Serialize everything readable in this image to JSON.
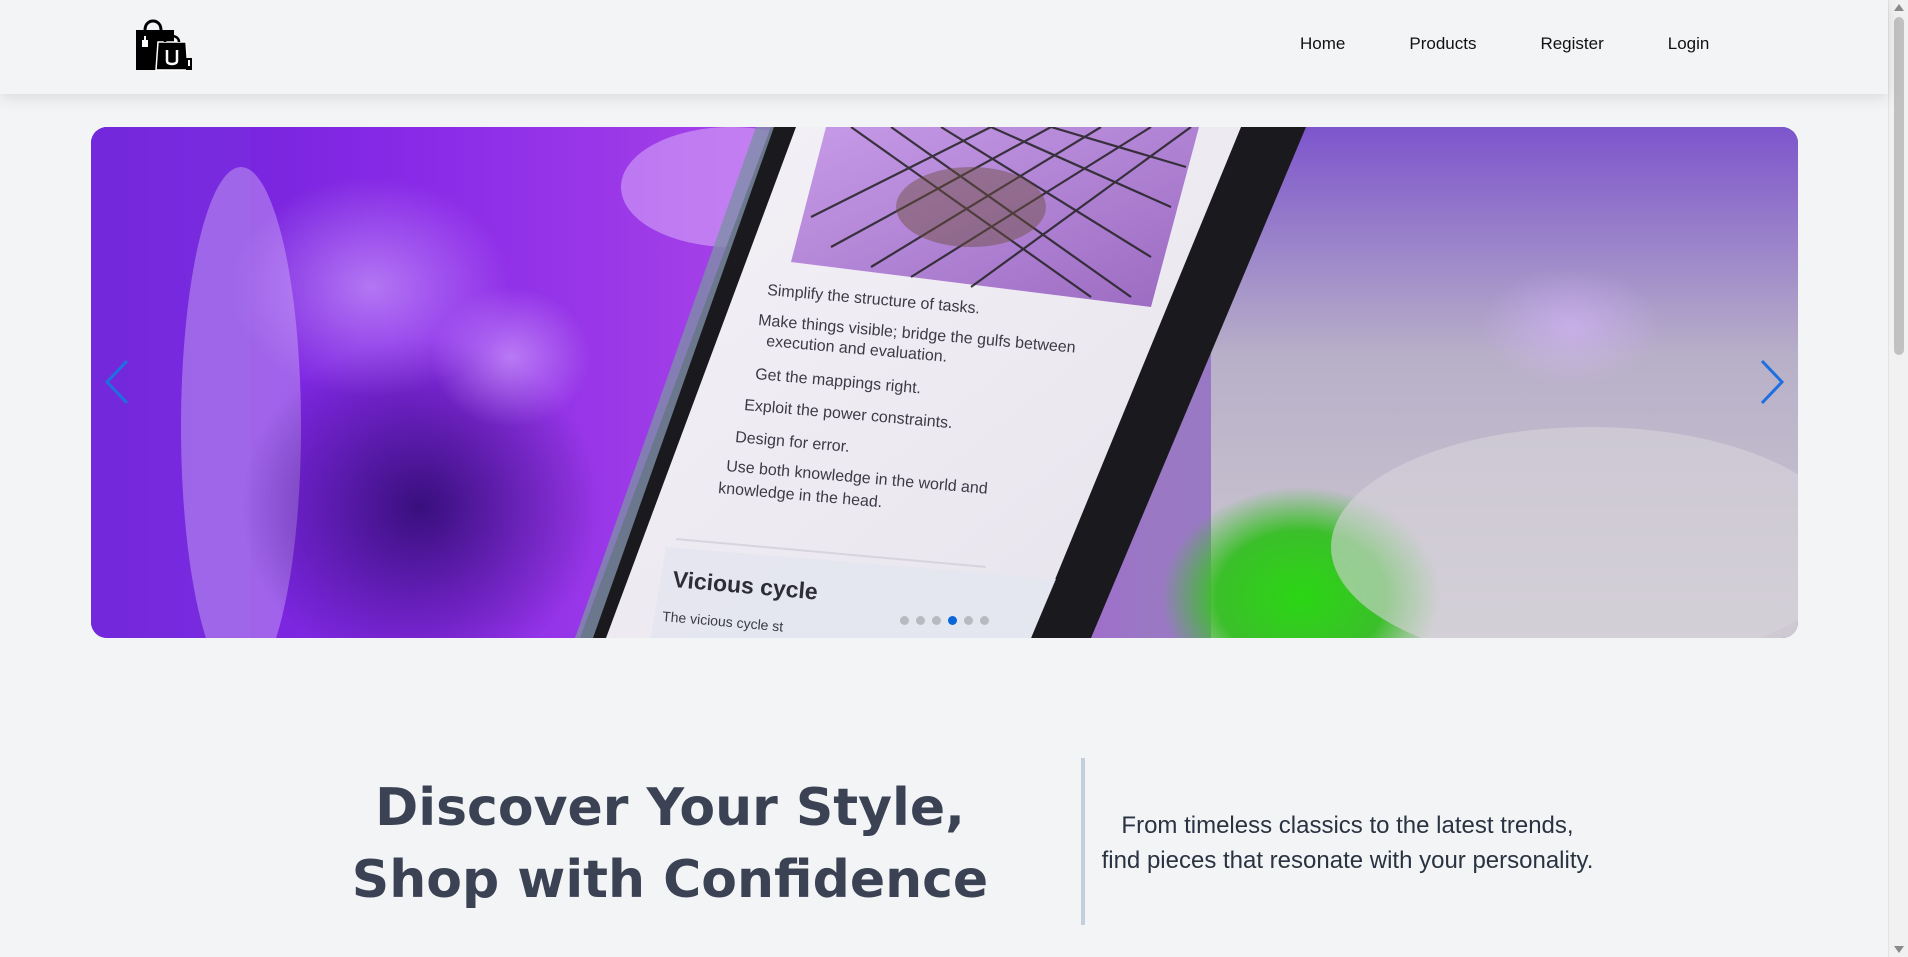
{
  "header": {
    "nav": {
      "home": "Home",
      "products": "Products",
      "register": "Register",
      "login": "Login"
    }
  },
  "hero": {
    "slide_count": 6,
    "active_slide": 4,
    "screen_text": {
      "bullet_1": "Simplify the structure of tasks.",
      "bullet_2a": "Make things visible; bridge the gulfs between",
      "bullet_2b": "execution and evaluation.",
      "bullet_3": "Get the mappings right.",
      "bullet_4": "Exploit the power constraints.",
      "bullet_5": "Design for error.",
      "bullet_6a": "Use both knowledge in the world and",
      "bullet_6b": "knowledge in the head.",
      "section_title": "Vicious cycle",
      "section_body": "The vicious cycle st"
    }
  },
  "intro": {
    "title": "Discover Your Style, Shop with Confidence",
    "text": "From timeless classics to the latest trends, find pieces that resonate with your personality."
  },
  "colors": {
    "background": "#f3f4f6",
    "accent": "#0b66d8",
    "heading": "#3a4254"
  }
}
